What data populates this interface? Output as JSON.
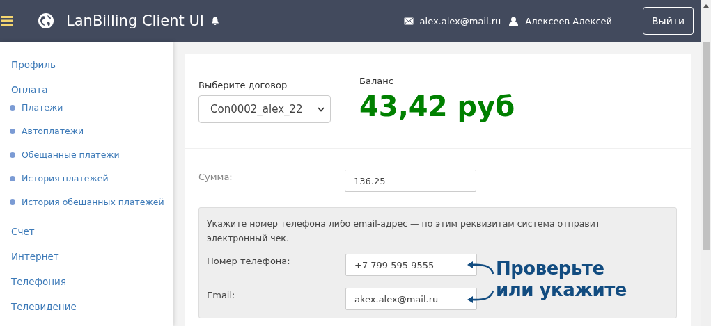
{
  "header": {
    "title": "LanBilling Client UI",
    "email": "alex.alex@mail.ru",
    "user": "Алексеев Алексей",
    "logout_button": "Выйти"
  },
  "sidebar": {
    "items": [
      {
        "label": "Профиль"
      },
      {
        "label": "Оплата",
        "children": [
          {
            "label": "Платежи"
          },
          {
            "label": "Автоплатежи"
          },
          {
            "label": "Обещанные платежи"
          },
          {
            "label": "История платежей"
          },
          {
            "label": "История обещанных платежей"
          }
        ]
      },
      {
        "label": "Счет"
      },
      {
        "label": "Интернет"
      },
      {
        "label": "Телефония"
      },
      {
        "label": "Телевидение"
      }
    ]
  },
  "contract": {
    "label": "Выберите договор",
    "value": "Con0002_alex_22"
  },
  "balance": {
    "label": "Баланс",
    "value": "43,42 руб"
  },
  "amount": {
    "label": "Сумма:",
    "value": "136.25"
  },
  "receipt": {
    "note": "Укажите номер телефона либо email-адрес — по этим реквизитам система отправит электронный чек.",
    "fields": [
      {
        "label": "Номер телефона:",
        "value": "+7 799 595 9555"
      },
      {
        "label": "Email:",
        "value": "akex.alex@mail.ru"
      }
    ]
  },
  "annotation": {
    "lines": [
      "Проверьте",
      "или укажите"
    ]
  }
}
